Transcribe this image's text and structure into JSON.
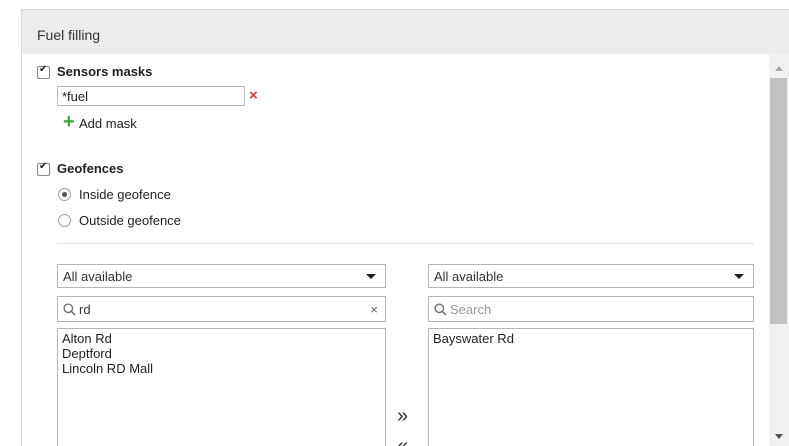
{
  "panel": {
    "title": "Fuel filling"
  },
  "sensors": {
    "checked": true,
    "label": "Sensors masks",
    "mask_value": "*fuel",
    "remove_symbol": "×",
    "add_label": "Add mask"
  },
  "geofences": {
    "checked": true,
    "label": "Geofences",
    "options": [
      {
        "label": "Inside geofence",
        "selected": true
      },
      {
        "label": "Outside geofence",
        "selected": false
      }
    ]
  },
  "left_list": {
    "filter": "All available",
    "search_value": "rd",
    "clear_symbol": "×",
    "items": [
      "Alton Rd",
      "Deptford",
      "Lincoln RD Mall"
    ]
  },
  "right_list": {
    "filter": "All available",
    "search_placeholder": "Search",
    "items": [
      "Bayswater Rd"
    ]
  },
  "transfer": {
    "add_all": "»",
    "remove_all": "«"
  },
  "colors": {
    "remove": "#e0342f",
    "add": "#3ca63c",
    "header_bg": "#ececec"
  },
  "icons": [
    "checkbox-icon",
    "remove-icon",
    "plus-icon",
    "radio-icon",
    "search-icon",
    "chevron-down-icon",
    "double-right-arrow-icon",
    "double-left-arrow-icon"
  ]
}
